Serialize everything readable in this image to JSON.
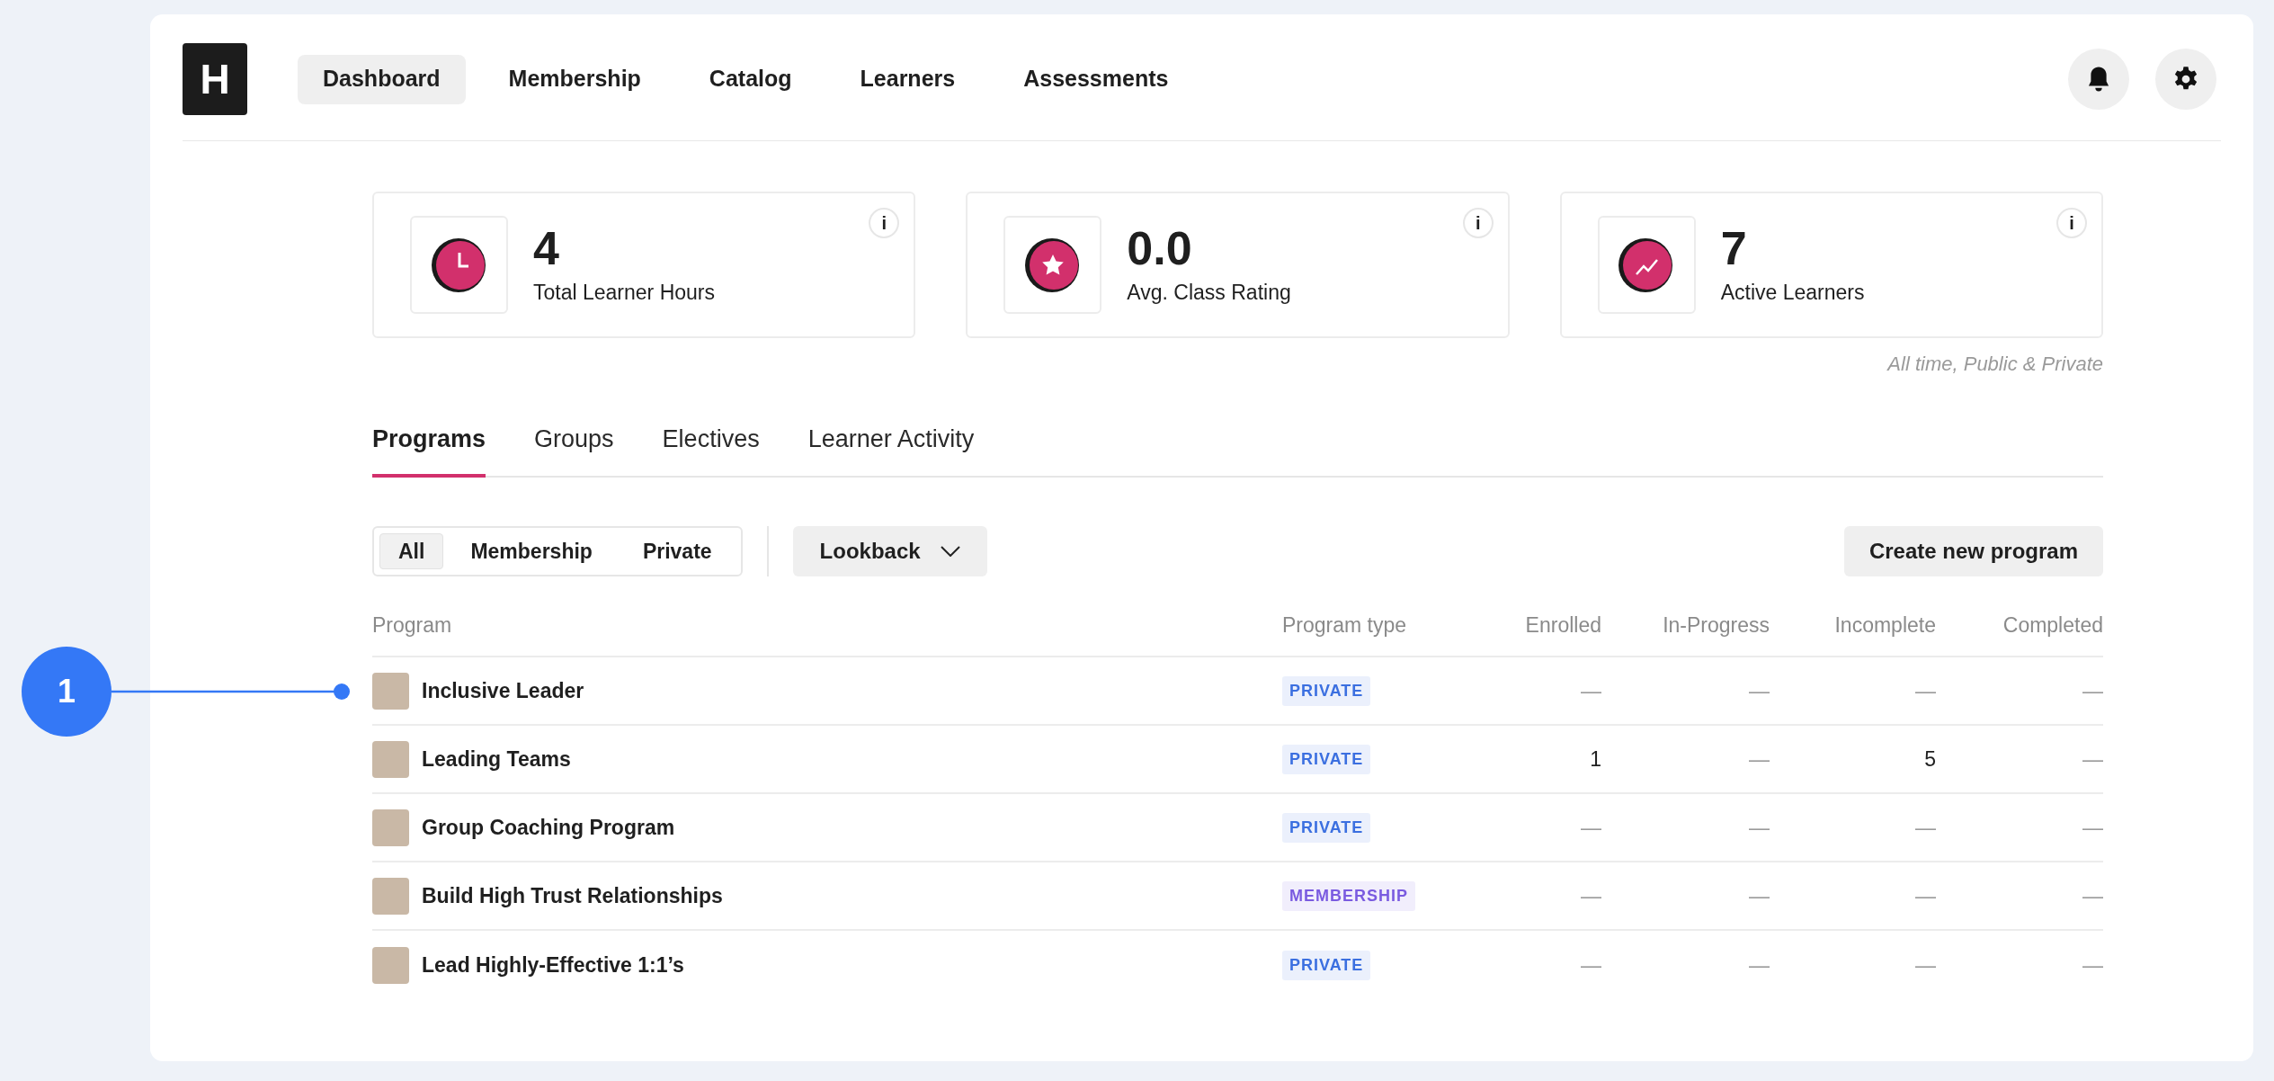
{
  "nav": {
    "logo": "H",
    "items": [
      {
        "label": "Dashboard",
        "selected": true
      },
      {
        "label": "Membership",
        "selected": false
      },
      {
        "label": "Catalog",
        "selected": false
      },
      {
        "label": "Learners",
        "selected": false
      },
      {
        "label": "Assessments",
        "selected": false
      }
    ]
  },
  "stats": [
    {
      "kind": "clock",
      "value": "4",
      "label": "Total Learner Hours",
      "info": "i"
    },
    {
      "kind": "star",
      "value": "0.0",
      "label": "Avg. Class Rating",
      "info": "i"
    },
    {
      "kind": "trend",
      "value": "7",
      "label": "Active Learners",
      "info": "i"
    }
  ],
  "stats_note": "All time, Public & Private",
  "tabs": [
    {
      "label": "Programs",
      "selected": true
    },
    {
      "label": "Groups",
      "selected": false
    },
    {
      "label": "Electives",
      "selected": false
    },
    {
      "label": "Learner Activity",
      "selected": false
    }
  ],
  "filters": [
    {
      "label": "All",
      "selected": true
    },
    {
      "label": "Membership",
      "selected": false
    },
    {
      "label": "Private",
      "selected": false
    }
  ],
  "lookback": "Lookback",
  "create_button": "Create new program",
  "table": {
    "columns": [
      "Program",
      "Program type",
      "Enrolled",
      "In-Progress",
      "Incomplete",
      "Completed"
    ],
    "rows": [
      {
        "annotation": "1",
        "program": "Inclusive Leader",
        "program_type": {
          "label": "PRIVATE",
          "color": "#3b6fe0"
        },
        "enrolled": "—",
        "in_progress": "—",
        "incomplete": "—",
        "completed": "—"
      },
      {
        "program": "Leading Teams",
        "program_type": {
          "label": "PRIVATE",
          "color": "#3b6fe0"
        },
        "enrolled": "1",
        "in_progress": "—",
        "incomplete": "5",
        "completed": "—"
      },
      {
        "program": "Group Coaching Program",
        "program_type": {
          "label": "PRIVATE",
          "color": "#3b6fe0"
        },
        "enrolled": "—",
        "in_progress": "—",
        "incomplete": "—",
        "completed": "—"
      },
      {
        "program": "Build High Trust Relationships",
        "program_type": {
          "label": "MEMBERSHIP",
          "color": "#7a5be0"
        },
        "enrolled": "—",
        "in_progress": "—",
        "incomplete": "—",
        "completed": "—"
      },
      {
        "program": "Lead Highly-Effective 1:1’s",
        "program_type": {
          "label": "PRIVATE",
          "color": "#3b6fe0"
        },
        "enrolled": "—",
        "in_progress": "—",
        "incomplete": "—",
        "completed": "—"
      }
    ]
  }
}
